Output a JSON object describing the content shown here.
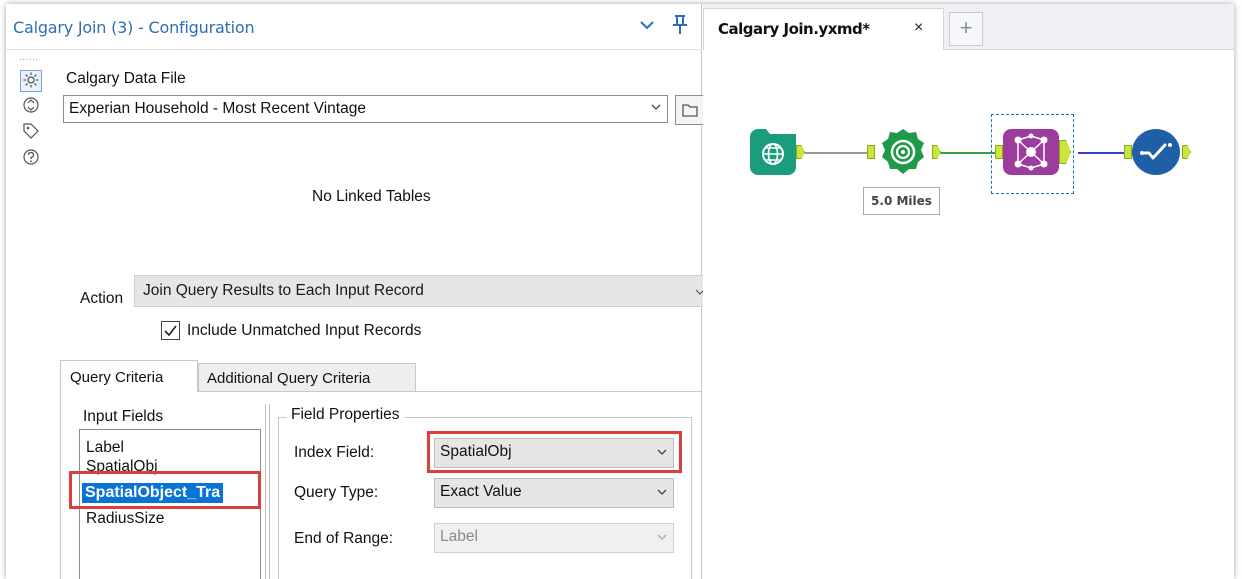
{
  "config": {
    "title": "Calgary Join (3) - Configuration",
    "grip": "......",
    "data_file_label": "Calgary Data File",
    "data_file_value": "Experian Household - Most Recent Vintage",
    "no_linked_tables": "No Linked Tables",
    "action_label": "Action",
    "action_value": "Join Query Results to Each Input Record",
    "include_unmatched_label": "Include Unmatched Input Records",
    "include_unmatched_checked": true,
    "tabs": [
      {
        "label": "Query Criteria",
        "active": true
      },
      {
        "label": "Additional Query Criteria",
        "active": false
      }
    ],
    "input_fields_label": "Input Fields",
    "input_fields": [
      "Label",
      "SpatialObj",
      "SpatialObject_Tra",
      "RadiusSize"
    ],
    "selected_input_field": "SpatialObject_Tra",
    "field_properties_label": "Field Properties",
    "index_field_label": "Index Field:",
    "index_field_value": "SpatialObj",
    "query_type_label": "Query Type:",
    "query_type_value": "Exact Value",
    "end_of_range_label": "End of Range:",
    "end_of_range_value": "Label",
    "highlight_color": "#d9403a"
  },
  "workflow": {
    "tab_label": "Calgary Join.yxmd*",
    "close_glyph": "×",
    "new_tab_glyph": "+",
    "radius_annotation": "5.0 Miles",
    "tools": [
      {
        "name": "input-tool",
        "color": "#1a9d7c",
        "icon": "globe-icon"
      },
      {
        "name": "trade-area-tool",
        "color": "#1f9a4b",
        "icon": "target-icon"
      },
      {
        "name": "calgary-join-tool",
        "color": "#9c3c9c",
        "icon": "join-network-icon"
      },
      {
        "name": "browse-tool",
        "color": "#1e5fa6",
        "icon": "check-wave-icon"
      }
    ]
  }
}
